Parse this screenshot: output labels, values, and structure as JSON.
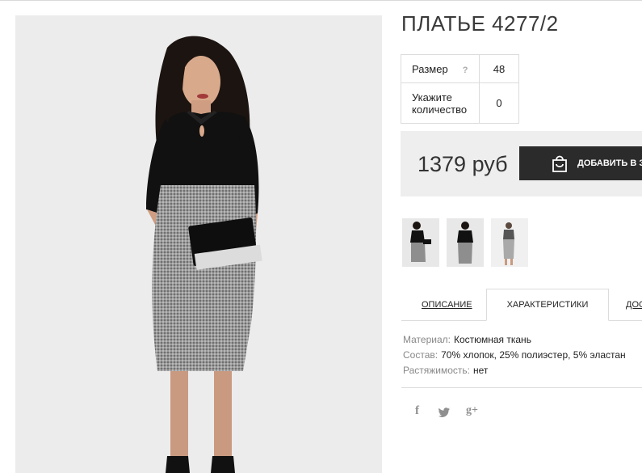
{
  "product": {
    "title": "ПЛАТЬЕ 4277/2",
    "size_label": "Размер",
    "size_help": "?",
    "size_value": "48",
    "qty_label_line1": "Укажите",
    "qty_label_line2": "количество",
    "qty_value": "0",
    "price": "1379 руб",
    "add_to_cart": "ДОБАВИТЬ В ЗАКАЗ"
  },
  "tabs": [
    {
      "label": "ОПИСАНИЕ"
    },
    {
      "label": "ХАРАКТЕРИСТИКИ"
    },
    {
      "label": "ДОСТАВКА"
    }
  ],
  "characteristics": [
    {
      "key": "Материал:",
      "value": "Костюмная ткань"
    },
    {
      "key": "Состав:",
      "value": "70% хлопок, 25% полиэстер, 5% эластан"
    },
    {
      "key": "Растяжимость:",
      "value": "нет"
    }
  ],
  "social": {
    "facebook_icon": "f",
    "twitter_icon": "twitter-bird",
    "googleplus_icon": "g+"
  },
  "colors": {
    "button_bg": "#2b2b2b",
    "price_bg": "#eeeeee",
    "photo_bg": "#ececed"
  }
}
